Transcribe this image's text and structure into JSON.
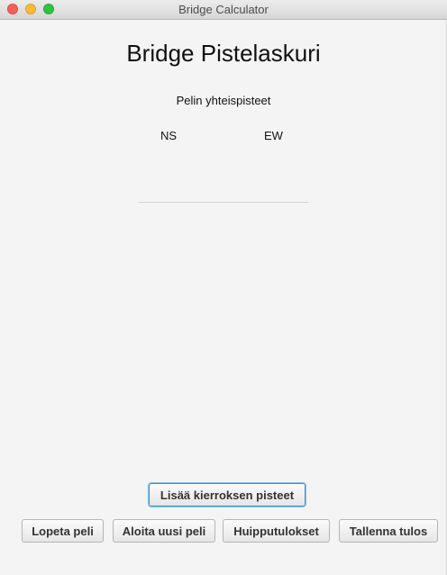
{
  "window": {
    "title": "Bridge Calculator"
  },
  "main": {
    "heading": "Bridge Pistelaskuri",
    "subheading": "Pelin yhteispisteet",
    "teams": {
      "ns": "NS",
      "ew": "EW"
    }
  },
  "buttons": {
    "add_round": "Lisää kierroksen pisteet",
    "end_game": "Lopeta peli",
    "new_game": "Aloita uusi peli",
    "high_scores": "Huipputulokset",
    "save_result": "Tallenna tulos"
  },
  "colors": {
    "focus_ring": "#2f93d9",
    "background": "#f4f4f4"
  }
}
